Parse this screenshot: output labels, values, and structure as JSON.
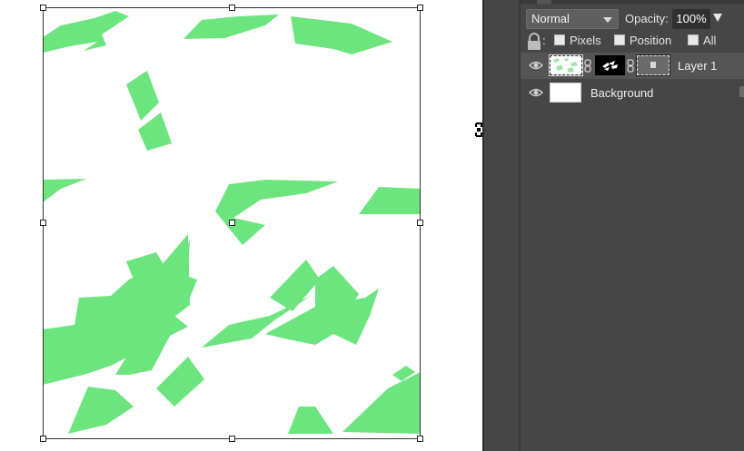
{
  "layers_panel": {
    "blend_mode": "Normal",
    "opacity_label": "Opacity:",
    "opacity_value": "100%",
    "lock_colon": ":",
    "lock_options": [
      "Pixels",
      "Position",
      "All"
    ],
    "layers": [
      {
        "name": "Layer 1",
        "selected": true
      },
      {
        "name": "Background",
        "selected": false
      }
    ]
  },
  "colors": {
    "shape_fill": "#6de57f",
    "panel_bg": "#464646",
    "selected_row": "#545454"
  },
  "icons": [
    "eye-icon",
    "lock-icon",
    "chain-link-icon",
    "move-cursor-icon",
    "dropdown-caret-icon"
  ]
}
